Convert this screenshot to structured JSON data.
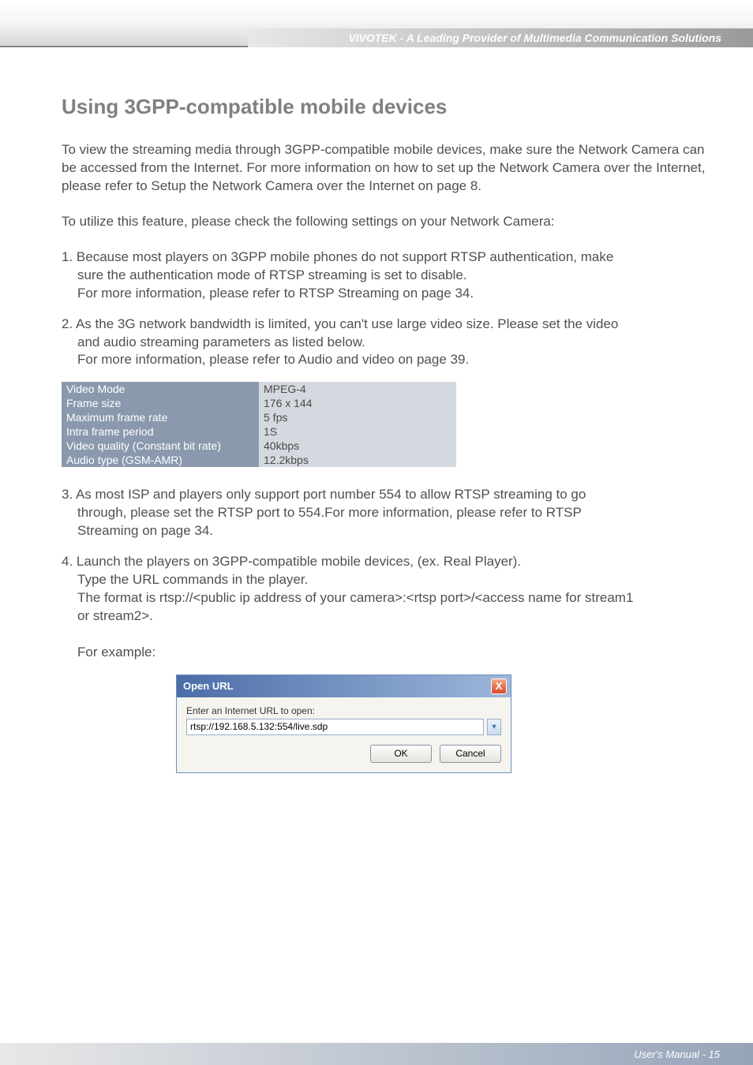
{
  "header": {
    "brand_tagline": "VIVOTEK - A Leading Provider of Multimedia Communication Solutions"
  },
  "section": {
    "title": "Using 3GPP-compatible mobile devices"
  },
  "paragraphs": {
    "intro": "To view the streaming media through 3GPP-compatible mobile devices, make sure the Network Camera can be accessed from the Internet. For more information on how to set up the Network Camera over the Internet, please refer to Setup the Network Camera over the Internet on page 8.",
    "lead": "To utilize this feature, please check the following settings on your Network Camera:"
  },
  "items": {
    "i1_l1": "1. Because most players on 3GPP mobile phones do not support RTSP authentication, make",
    "i1_l2": "sure the authentication mode of RTSP streaming is set to disable.",
    "i1_l3": "For more information, please refer to RTSP Streaming on page 34.",
    "i2_l1": "2. As the 3G network bandwidth is limited, you can't use large video size. Please set the video",
    "i2_l2": "and audio streaming parameters as listed below.",
    "i2_l3": "For more information, please refer to Audio and video on page 39.",
    "i3_l1": "3. As most ISP and players only support port number 554 to allow RTSP streaming to go",
    "i3_l2": "through, please set the RTSP port to 554.For more information, please refer to RTSP",
    "i3_l3": "Streaming on page 34.",
    "i4_l1": "4. Launch the players on 3GPP-compatible mobile devices, (ex. Real Player).",
    "i4_l2": "Type the URL commands in the player.",
    "i4_l3": "The format is rtsp://<public ip address of your camera>:<rtsp port>/<access name for stream1",
    "i4_l4": "or stream2>.",
    "i4_l5": "For example:"
  },
  "table": {
    "rows": [
      {
        "label": "Video Mode",
        "value": "MPEG-4"
      },
      {
        "label": "Frame size",
        "value": "176 x 144"
      },
      {
        "label": "Maximum frame rate",
        "value": "5 fps"
      },
      {
        "label": "Intra frame period",
        "value": "1S"
      },
      {
        "label": "Video quality (Constant bit rate)",
        "value": "40kbps"
      },
      {
        "label": "Audio type (GSM-AMR)",
        "value": "12.2kbps"
      }
    ]
  },
  "dialog": {
    "title": "Open URL",
    "label": "Enter an Internet URL to open:",
    "url_value": "rtsp://192.168.5.132:554/live.sdp",
    "ok": "OK",
    "cancel": "Cancel",
    "close_x": "X"
  },
  "footer": {
    "text": "User's Manual - 15"
  }
}
